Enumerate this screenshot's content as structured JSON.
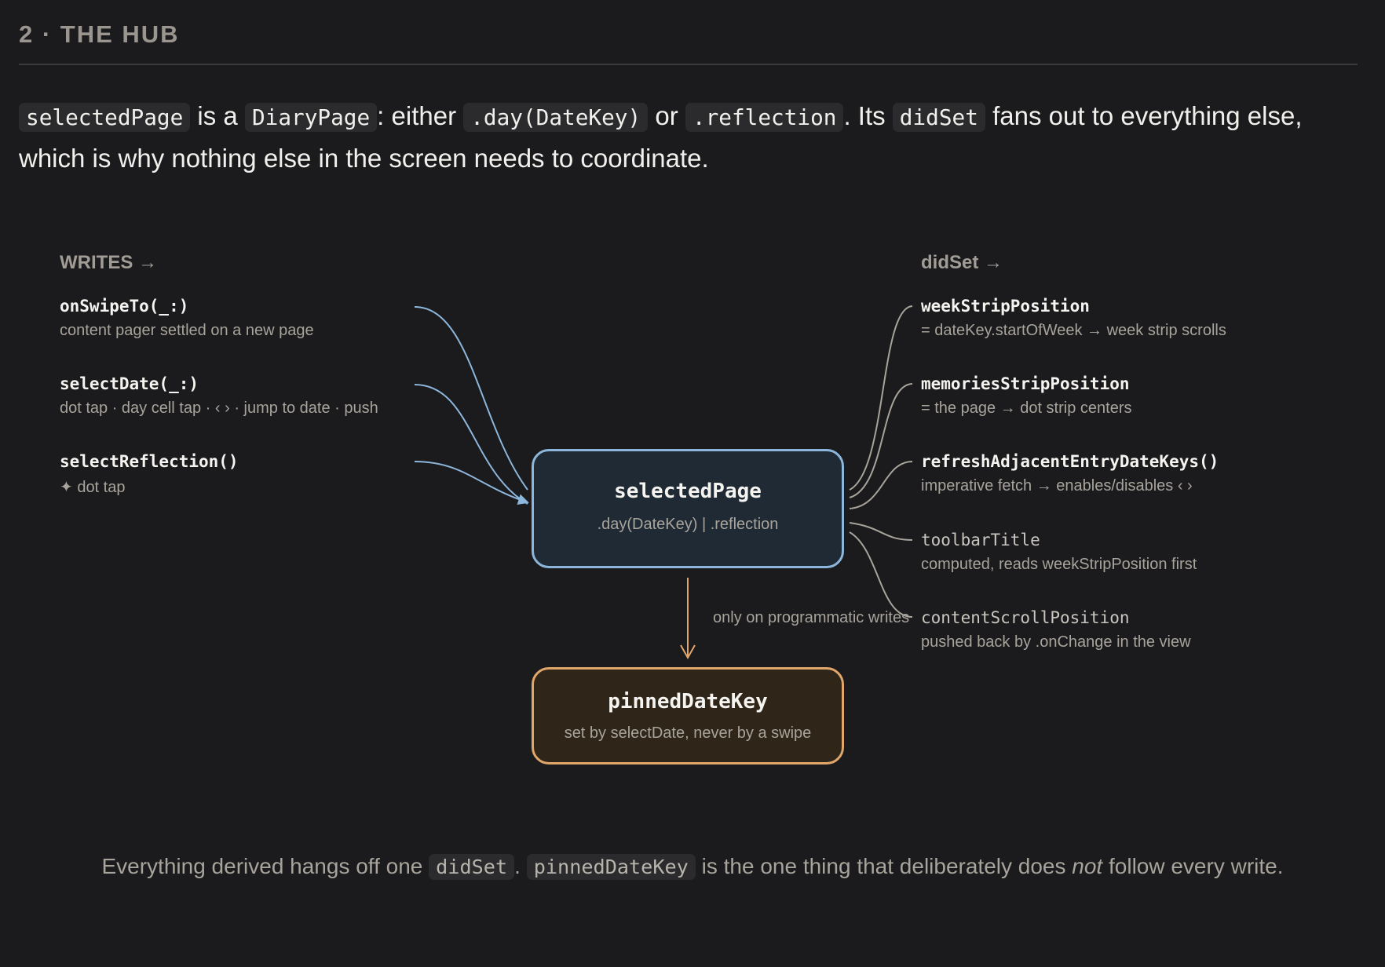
{
  "section": {
    "title": "2 · THE HUB"
  },
  "intro": {
    "code_selectedPage": "selectedPage",
    "t1": " is a ",
    "code_diaryPage": "DiaryPage",
    "t2": ": either ",
    "code_day": ".day(DateKey)",
    "t3": " or ",
    "code_reflection": ".reflection",
    "t4": ". Its ",
    "code_didSet": "didSet",
    "t5": " fans out to everything else, which is why nothing else in the screen needs to coordinate."
  },
  "writes": {
    "heading": "WRITES →",
    "items": [
      {
        "name": "onSwipeTo(_:)",
        "desc": "content pager settled on a new page"
      },
      {
        "name": "selectDate(_:)",
        "desc": "dot tap · day cell tap · ‹ › · jump to date · push"
      },
      {
        "name": "selectReflection()",
        "desc": "✦ dot tap"
      }
    ]
  },
  "didset": {
    "heading": "didSet →",
    "items": [
      {
        "name": "weekStripPosition",
        "desc": "= dateKey.startOfWeek → week strip scrolls"
      },
      {
        "name": "memoriesStripPosition",
        "desc": "= the page → dot strip centers"
      },
      {
        "name": "refreshAdjacentEntryDateKeys()",
        "desc": "imperative fetch → enables/disables ‹ ›"
      },
      {
        "name": "toolbarTitle",
        "desc": "computed, reads weekStripPosition first"
      },
      {
        "name": "contentScrollPosition",
        "desc": "pushed back by .onChange in the view"
      }
    ]
  },
  "hub": {
    "title": "selectedPage",
    "subtitle": ".day(DateKey) | .reflection"
  },
  "pinned": {
    "title": "pinnedDateKey",
    "subtitle": "set by selectDate, never by a swipe"
  },
  "edge": {
    "label": "only on programmatic writes"
  },
  "footer": {
    "t1": "Everything derived hangs off one ",
    "code_didSet": "didSet",
    "t2": ". ",
    "code_pinned": "pinnedDateKey",
    "t3": " is the one thing that deliberately does ",
    "em": "not",
    "t4": " follow every write."
  },
  "colors": {
    "writes_wire": "#8db6dc",
    "didset_wire": "#a8a49c",
    "pinned_wire": "#e1a66a"
  }
}
